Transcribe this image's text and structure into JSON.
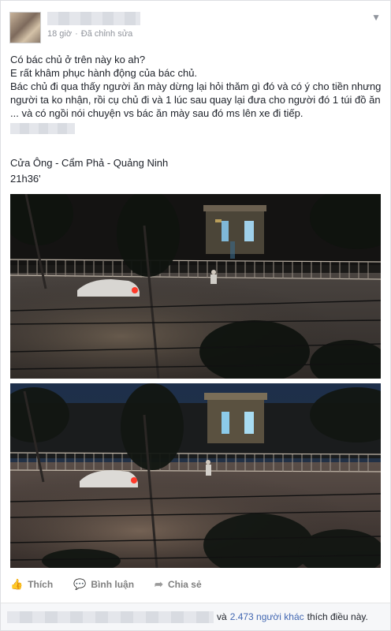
{
  "post": {
    "time_ago": "18 giờ",
    "separator": "·",
    "edited": "Đã chỉnh sửa",
    "lines": [
      "Có bác chủ ở trên này ko ah?",
      "E rất khâm phục hành động của bác chủ.",
      "Bác chủ đi qua thấy người ăn mày dừng lại hỏi thăm gì đó và có ý cho tiền nhưng người ta ko nhận, rồi cụ chủ đi và 1 lúc sau quay lại đưa cho người đó 1 túi đồ ăn ... và có ngồi nói chuyện vs bác ăn mày sau đó ms lên xe đi tiếp."
    ],
    "location": "Cửa Ông - Cẩm Phả - Quảng Ninh",
    "time": "21h36'"
  },
  "actions": {
    "like": "Thích",
    "comment": "Bình luận",
    "share": "Chia sẻ"
  },
  "likes": {
    "and": "và",
    "others": "2.473 người khác",
    "suffix": "thích điều này."
  },
  "icons": {
    "like": "thumbs-up-icon",
    "comment": "comment-icon",
    "share": "share-arrow-icon",
    "menu": "chevron-down-icon"
  }
}
